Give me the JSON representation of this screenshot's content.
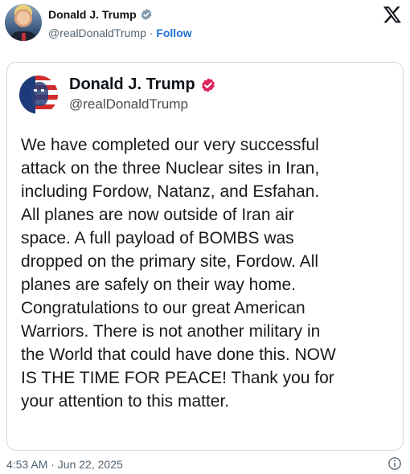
{
  "header": {
    "name": "Donald J. Trump",
    "handle": "@realDonaldTrump",
    "separator": "·",
    "follow_label": "Follow"
  },
  "card": {
    "name": "Donald J. Trump",
    "handle": "@realDonaldTrump",
    "body": "We have completed our very successful\nattack on the three Nuclear sites in Iran,\nincluding Fordow, Natanz, and Esfahan.\nAll planes are now outside of Iran air\nspace. A full payload of BOMBS was\ndropped on the primary site, Fordow. All\nplanes are safely on their way home.\nCongratulations to our great American\nWarriors. There is not another military in\nthe World that could have done this. NOW\nIS THE TIME FOR PEACE! Thank you for\nyour attention to this matter."
  },
  "footer": {
    "timestamp": "4:53 AM · Jun 22, 2025"
  },
  "icons": {
    "verified_badge_header": "verified-badge-gray",
    "verified_badge_card": "verified-badge-red",
    "brand": "x-logo",
    "info": "info-circle"
  },
  "colors": {
    "follow_link": "#1d6fd1",
    "card_badge": "#e0245e",
    "header_badge": "#829aab",
    "muted_text": "#536471"
  }
}
